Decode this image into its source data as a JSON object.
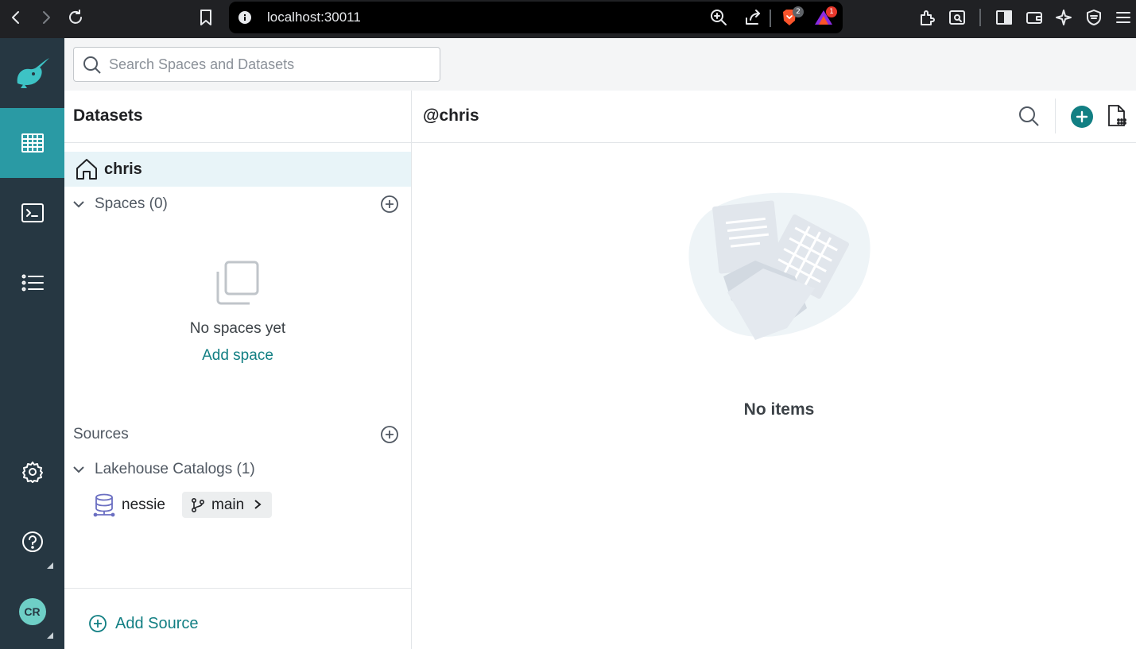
{
  "browser": {
    "url": "localhost:30011",
    "brave_badge_count": "2",
    "rewards_badge_count": "1"
  },
  "search": {
    "placeholder": "Search Spaces and Datasets"
  },
  "datasets_panel": {
    "title": "Datasets",
    "home_label": "chris",
    "spaces_label": "Spaces (0)",
    "empty_spaces_text": "No spaces yet",
    "add_space_label": "Add space",
    "sources_label": "Sources",
    "catalogs_label": "Lakehouse Catalogs (1)",
    "source_name": "nessie",
    "branch_name": "main",
    "add_source_label": "Add Source"
  },
  "main": {
    "title": "@chris",
    "empty_text": "No items"
  },
  "user": {
    "initials": "CR"
  },
  "colors": {
    "nav_bg": "#263742",
    "nav_active": "#2a9aa4",
    "accent": "#127f83",
    "home_row_bg": "#e8f4f8"
  },
  "icons": {
    "nav": [
      "datasets-grid-icon",
      "sql-terminal-icon",
      "jobs-list-icon",
      "settings-gear-icon",
      "help-icon"
    ]
  }
}
